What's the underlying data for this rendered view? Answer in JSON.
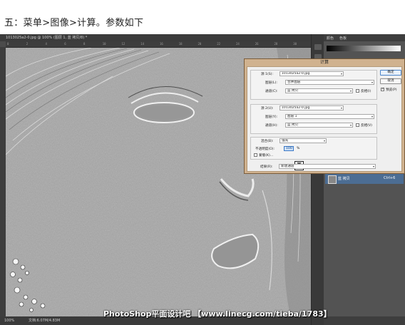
{
  "caption": "五：菜单>图像>计算。参数如下",
  "document": {
    "tab_title": "1013025a2-0.jpg @ 100% (图层 1, 蓝 拷贝/8) *",
    "ruler_ticks": [
      "0",
      "2",
      "4",
      "6",
      "8",
      "10",
      "12",
      "14",
      "16",
      "18",
      "20",
      "22",
      "24",
      "26",
      "28",
      "30"
    ],
    "status_zoom": "100%",
    "status_doc": "文档:6.07M/4.83M"
  },
  "panels": {
    "tab1": "颜色",
    "tab2": "色板",
    "layer_name": "蓝 拷贝",
    "layer_shortcut": "Ctrl+6"
  },
  "dialog": {
    "title": "计算",
    "source1": {
      "label": "源 1(S):",
      "file": "1013025a2-0.jpg",
      "layer_label": "图层(L):",
      "layer": "合并图层",
      "channel_label": "通道(C):",
      "channel": "蓝 拷贝",
      "invert_label": "反相(I)",
      "invert": false
    },
    "source2": {
      "label": "源 2(U):",
      "file": "1013025a2-0.jpg",
      "layer_label": "图层(Y):",
      "layer": "图层 1",
      "channel_label": "通道(H):",
      "channel": "蓝 拷贝",
      "invert_label": "反相(V)",
      "invert": false
    },
    "blending": {
      "label": "混合(B):",
      "mode": "强光",
      "opacity_label": "不透明度(O):",
      "opacity": "100",
      "percent": "%",
      "mask_label": "蒙版(K)...",
      "mask": false
    },
    "result": {
      "label": "结果(R):",
      "value": "新建通道"
    },
    "buttons": {
      "ok": "确定",
      "cancel": "取消",
      "preview_label": "预览(P)",
      "preview": true
    },
    "ime_char": "英"
  },
  "watermark": "PhotoShop平面设计吧 【www.linecg.com/tieba/1783】"
}
